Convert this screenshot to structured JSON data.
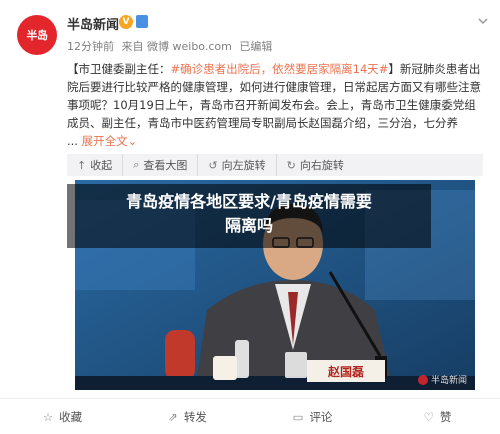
{
  "header": {
    "avatar_text": "半岛",
    "account_name": "半岛新闻",
    "verified_mark": "V",
    "meta": {
      "time": "12分钟前",
      "source": "来自 微博 weibo.com",
      "edited": "已编辑"
    }
  },
  "post": {
    "prefix": "【市卫健委副主任：",
    "topic": "#确诊患者出院后，依然要居家隔离14天#",
    "body": "】新冠肺炎患者出院后要进行比较严格的健康管理，如何进行健康管理，日常起居方面又有哪些注意事项呢？10月19日上午，青岛市召开新闻发布会。会上，青岛市卫生健康委党组成员、副主任，青岛市中医药管理局专职副局长赵国磊介绍，三分治，七分养",
    "ellipsis": "...",
    "expand_label": "展开全文",
    "expand_arrow": "⌄"
  },
  "actions": [
    {
      "icon": "↑",
      "label": "收起"
    },
    {
      "icon": "⌕",
      "label": "查看大图"
    },
    {
      "icon": "↺",
      "label": "向左旋转"
    },
    {
      "icon": "↻",
      "label": "向右旋转"
    }
  ],
  "overlay": {
    "line1": "青岛疫情各地区要求/青岛疫情需要",
    "line2": "隔离吗"
  },
  "image": {
    "nameplate": "赵国磊",
    "watermark": "半岛新闻"
  },
  "bottom": [
    {
      "icon": "☆",
      "label": "收藏"
    },
    {
      "icon": "⇗",
      "label": "转发"
    },
    {
      "icon": "▭",
      "label": "评论"
    },
    {
      "icon": "♡",
      "label": "赞"
    }
  ],
  "colors": {
    "brand_red": "#e3262c",
    "link_orange": "#eb7350",
    "backdrop_blue": "#1f4e7a"
  }
}
